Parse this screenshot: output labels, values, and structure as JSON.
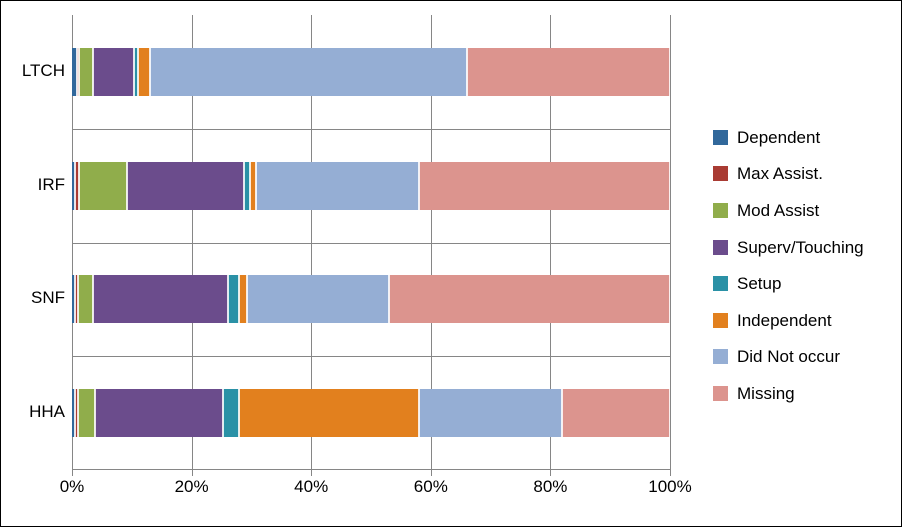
{
  "chart_data": {
    "type": "bar",
    "orientation": "horizontal",
    "stacked": true,
    "stack_mode": "percent",
    "title": "",
    "xlabel": "",
    "ylabel": "",
    "xlim": [
      0,
      100
    ],
    "xticks": [
      0,
      20,
      40,
      60,
      80,
      100
    ],
    "xtick_labels": [
      "0%",
      "20%",
      "40%",
      "60%",
      "80%",
      "100%"
    ],
    "categories": [
      "HHA",
      "SNF",
      "IRF",
      "LTCH"
    ],
    "categories_top_to_bottom": [
      "LTCH",
      "IRF",
      "SNF",
      "HHA"
    ],
    "grid": true,
    "legend_position": "right",
    "series": [
      {
        "name": "Dependent",
        "color": "#31689B",
        "values": [
          0.5,
          0.5,
          0.5,
          0.9
        ]
      },
      {
        "name": "Max Assist.",
        "color": "#A93B33",
        "values": [
          0.5,
          0.5,
          0.6,
          0.2
        ]
      },
      {
        "name": "Mod Assist",
        "color": "#90AD4B",
        "values": [
          2.8,
          2.5,
          8.1,
          2.2
        ]
      },
      {
        "name": "Superv/Touching",
        "color": "#6B4C8C",
        "values": [
          21.4,
          22.6,
          19.5,
          7.0
        ]
      },
      {
        "name": "Setup",
        "color": "#2A91A6",
        "values": [
          2.7,
          1.9,
          1.0,
          0.7
        ]
      },
      {
        "name": "Independent",
        "color": "#E2801E",
        "values": [
          30.1,
          1.3,
          1.1,
          2.0
        ]
      },
      {
        "name": "Did Not occur",
        "color": "#95AED4",
        "values": [
          24.0,
          23.7,
          27.2,
          53.0
        ]
      },
      {
        "name": "Missing",
        "color": "#DC948E",
        "values": [
          18.0,
          47.0,
          42.0,
          34.0
        ]
      }
    ]
  },
  "legend": {
    "items": [
      {
        "label": "Dependent",
        "color": "#31689B"
      },
      {
        "label": "Max Assist.",
        "color": "#A93B33"
      },
      {
        "label": "Mod Assist",
        "color": "#90AD4B"
      },
      {
        "label": "Superv/Touching",
        "color": "#6B4C8C"
      },
      {
        "label": "Setup",
        "color": "#2A91A6"
      },
      {
        "label": "Independent",
        "color": "#E2801E"
      },
      {
        "label": "Did Not occur",
        "color": "#95AED4"
      },
      {
        "label": "Missing",
        "color": "#DC948E"
      }
    ]
  },
  "axes": {
    "x_tick_labels": [
      "0%",
      "20%",
      "40%",
      "60%",
      "80%",
      "100%"
    ],
    "y_tick_labels": [
      "LTCH",
      "IRF",
      "SNF",
      "HHA"
    ]
  }
}
